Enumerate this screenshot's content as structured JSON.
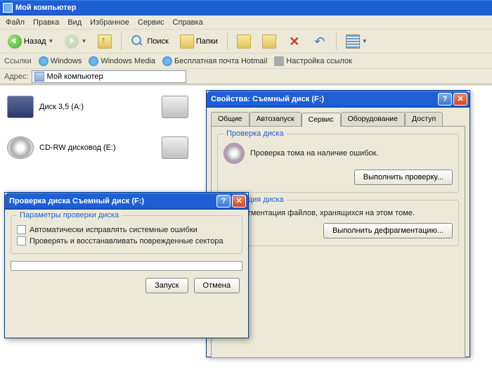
{
  "main": {
    "title": "Мой компьютер",
    "menu": [
      "Файл",
      "Правка",
      "Вид",
      "Избранное",
      "Сервис",
      "Справка"
    ],
    "toolbar": {
      "back": "Назад",
      "search": "Поиск",
      "folders": "Папки"
    },
    "links": {
      "label": "Ссылки",
      "items": [
        "Windows",
        "Windows Media",
        "Бесплатная почта Hotmail",
        "Настройка ссылок"
      ]
    },
    "address": {
      "label": "Адрес:",
      "value": "Мой компьютер"
    },
    "drives": {
      "floppy": "Диск 3,5 (A:)",
      "cd": "CD-RW дисковод (E:)"
    }
  },
  "props": {
    "title": "Свойства: Съемный диск (F:)",
    "tabs": [
      "Общие",
      "Автозапуск",
      "Сервис",
      "Оборудование",
      "Доступ"
    ],
    "check_group": {
      "title": "Проверка диска",
      "text": "Проверка тома на наличие ошибок.",
      "button": "Выполнить проверку..."
    },
    "defrag_group": {
      "title": "ментация диска",
      "text": "Дефрагментация файлов, хранящихся на этом томе.",
      "button": "Выполнить дефрагментацию..."
    }
  },
  "checkdlg": {
    "title": "Проверка диска Съемный диск (F:)",
    "group_title": "Параметры проверки диска",
    "opt1": "Автоматически исправлять системные ошибки",
    "opt2": "Проверять и восстанавливать поврежденные сектора",
    "start": "Запуск",
    "cancel": "Отмена"
  }
}
